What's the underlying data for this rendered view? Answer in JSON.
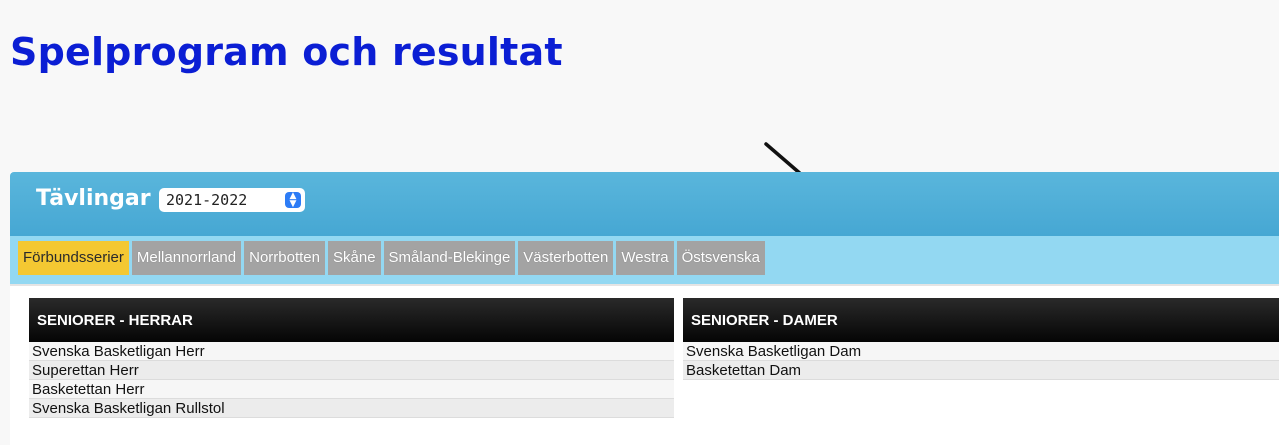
{
  "page": {
    "title": "Spelprogram och resultat"
  },
  "competitions": {
    "label": "Tävlingar",
    "season": {
      "selected": "2021-2022"
    }
  },
  "tabs": [
    {
      "label": "Förbundsserier",
      "active": true
    },
    {
      "label": "Mellannorrland"
    },
    {
      "label": "Norrbotten"
    },
    {
      "label": "Skåne"
    },
    {
      "label": "Småland-Blekinge"
    },
    {
      "label": "Västerbotten"
    },
    {
      "label": "Westra"
    },
    {
      "label": "Östsvenska"
    }
  ],
  "groups": [
    {
      "title": "SENIORER - HERRAR",
      "items": [
        "Svenska Basketligan Herr",
        "Superettan Herr",
        "Basketettan Herr",
        "Svenska Basketligan Rullstol"
      ]
    },
    {
      "title": "SENIORER - DAMER",
      "items": [
        "Svenska Basketligan Dam",
        "Basketettan Dam"
      ]
    }
  ],
  "colors": {
    "title": "#0b1ed4",
    "header_bar": "#4fafd8",
    "tab_bar": "#93d8f2",
    "tab_active": "#f4c832",
    "tab_inactive": "#a3a3a3"
  },
  "icons": {
    "annotation": "arrow-icon",
    "select": "stepper-icon"
  }
}
